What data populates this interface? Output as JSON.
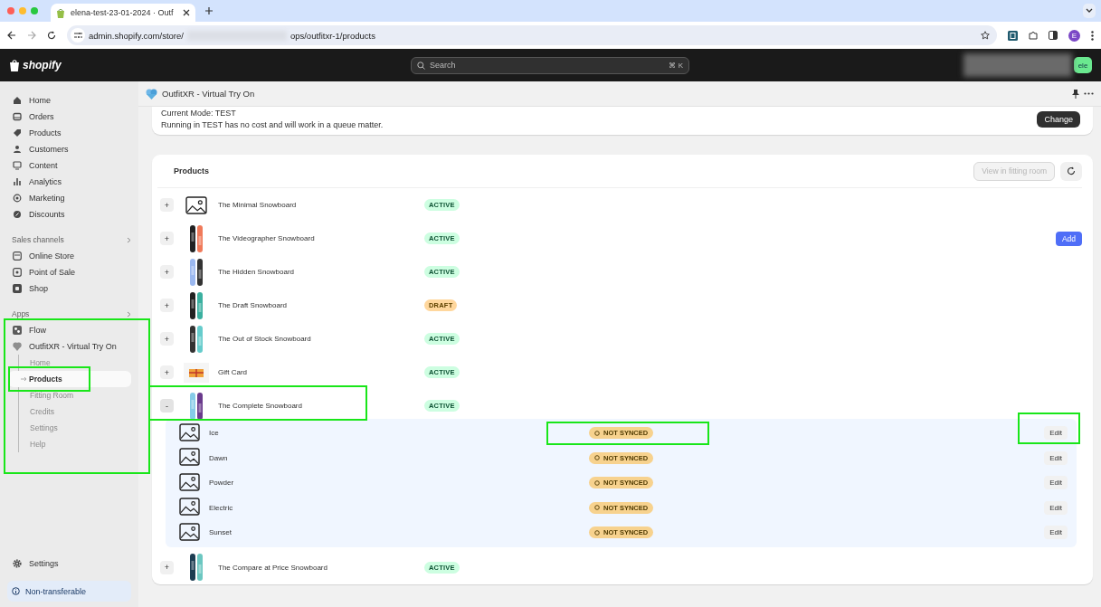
{
  "browser": {
    "tab_title": "elena-test-23-01-2024 · Outf",
    "url_start": "admin.shopify.com/store/",
    "url_end": "ops/outfitxr-1/products",
    "profile": "E"
  },
  "topbar": {
    "logo": "shopify",
    "search_placeholder": "Search",
    "shortcut": "⌘ K",
    "store_badge": "ele"
  },
  "sidebar": {
    "main": [
      {
        "label": "Home"
      },
      {
        "label": "Orders"
      },
      {
        "label": "Products"
      },
      {
        "label": "Customers"
      },
      {
        "label": "Content"
      },
      {
        "label": "Analytics"
      },
      {
        "label": "Marketing"
      },
      {
        "label": "Discounts"
      }
    ],
    "sales_channels": {
      "title": "Sales channels",
      "items": [
        {
          "label": "Online Store"
        },
        {
          "label": "Point of Sale"
        },
        {
          "label": "Shop"
        }
      ]
    },
    "apps": {
      "title": "Apps",
      "highlighted": true,
      "items": [
        {
          "label": "Flow"
        },
        {
          "label": "OutfitXR - Virtual Try On"
        }
      ],
      "sub_items": [
        {
          "label": "Home",
          "selected": false,
          "highlighted": false
        },
        {
          "label": "Products",
          "selected": true,
          "highlighted": true
        },
        {
          "label": "Fitting Room",
          "selected": false,
          "highlighted": false
        },
        {
          "label": "Credits",
          "selected": false,
          "highlighted": false
        },
        {
          "label": "Settings",
          "selected": false,
          "highlighted": false
        },
        {
          "label": "Help",
          "selected": false,
          "highlighted": false
        }
      ]
    },
    "settings": "Settings",
    "footer_notice": "Non-transferable"
  },
  "app": {
    "title": "OutfitXR - Virtual Try On",
    "mode_card": {
      "mode": "Current Mode: TEST",
      "description": "Running in TEST has no cost and will work in a queue matter.",
      "button": "Change"
    },
    "products": {
      "title": "Products",
      "view_button": {
        "label": "View in fitting room",
        "disabled": true
      },
      "rows": [
        {
          "toggle": "+",
          "name": "The Minimal Snowboard",
          "status": "ACTIVE",
          "color": "#cdfee1",
          "kind": "placeholder",
          "expanded": false,
          "highlighted": false
        },
        {
          "toggle": "+",
          "name": "The Videographer Snowboard",
          "status": "ACTIVE",
          "color": "#cdfee1",
          "kind": "picture",
          "expanded": false,
          "highlighted": false,
          "action": "Add"
        },
        {
          "toggle": "+",
          "name": "The Hidden Snowboard",
          "status": "ACTIVE",
          "color": "#cdfee1",
          "kind": "picture",
          "expanded": false,
          "highlighted": false
        },
        {
          "toggle": "+",
          "name": "The Draft Snowboard",
          "status": "DRAFT",
          "color": "#ffd79d",
          "kind": "picture",
          "expanded": false,
          "highlighted": false
        },
        {
          "toggle": "+",
          "name": "The Out of Stock Snowboard",
          "status": "ACTIVE",
          "color": "#cdfee1",
          "kind": "picture",
          "expanded": false,
          "highlighted": false
        },
        {
          "toggle": "+",
          "name": "Gift Card",
          "status": "ACTIVE",
          "color": "#cdfee1",
          "kind": "picture",
          "expanded": false,
          "highlighted": false
        },
        {
          "toggle": "-",
          "name": "The Complete Snowboard",
          "status": "ACTIVE",
          "color": "#cdfee1",
          "kind": "picture",
          "expanded": true,
          "highlighted": true,
          "variants": [
            {
              "name": "Ice",
              "status": "NOT SYNCED",
              "button": "Edit",
              "highlighted": true
            },
            {
              "name": "Dawn",
              "status": "NOT SYNCED",
              "button": "Edit",
              "highlighted": false
            },
            {
              "name": "Powder",
              "status": "NOT SYNCED",
              "button": "Edit",
              "highlighted": false
            },
            {
              "name": "Electric",
              "status": "NOT SYNCED",
              "button": "Edit",
              "highlighted": false
            },
            {
              "name": "Sunset",
              "status": "NOT SYNCED",
              "button": "Edit",
              "highlighted": false
            }
          ]
        },
        {
          "toggle": "+",
          "name": "The Compare at Price Snowboard",
          "status": "ACTIVE",
          "color": "#cdfee1",
          "kind": "picture",
          "expanded": false,
          "highlighted": false
        }
      ]
    }
  }
}
